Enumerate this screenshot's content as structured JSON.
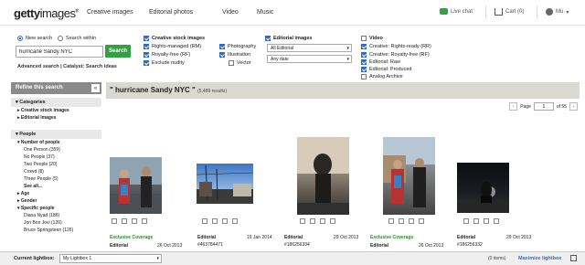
{
  "header": {
    "logo_bold": "getty",
    "logo_thin": "images",
    "logo_reg": "®",
    "nav": [
      "Creative images",
      "Editorial photos",
      "Video",
      "Music"
    ],
    "live_chat": "Live chat",
    "cart": "Cart (0)",
    "user": "Mu"
  },
  "search": {
    "mode_new": "New search",
    "mode_within": "Search within",
    "query": "hurricane Sandy NYC",
    "button": "Search",
    "advanced": "Advanced search",
    "divider": "|",
    "catalyst": "Catalyst: Search ideas"
  },
  "filters": {
    "creative_title": "Creative stock images",
    "creative_opts": [
      {
        "label": "Rights-managed (RM)",
        "checked": true
      },
      {
        "label": "Royalty-free (RF)",
        "checked": true
      },
      {
        "label": "Exclude nudity",
        "checked": true
      }
    ],
    "type_opts": [
      {
        "label": "Photography",
        "checked": true
      },
      {
        "label": "Illustration",
        "checked": true
      },
      {
        "label": "Vector",
        "checked": false
      }
    ],
    "editorial_title": "Editorial images",
    "editorial_select": "All Editorial",
    "date_select": "Any date",
    "video_title": "Video",
    "video_opts": [
      {
        "label": "Creative: Rights-ready (RR)",
        "checked": true
      },
      {
        "label": "Creative: Royalty-free (RF)",
        "checked": true
      },
      {
        "label": "Editorial: Raw",
        "checked": true
      },
      {
        "label": "Editorial: Produced",
        "checked": true
      },
      {
        "label": "Analog Archive",
        "checked": false
      }
    ]
  },
  "sidebar": {
    "title": "Refine this search",
    "collapse": "«",
    "categories_title": "Categories",
    "categories": [
      "Creative stock images",
      "Editorial images"
    ],
    "people_title": "People",
    "number_title": "Number of people",
    "number_items": [
      "One Person (359)",
      "No People (37)",
      "Two People (20)",
      "Crowd (8)",
      "Three People (5)"
    ],
    "see_all": "See all...",
    "age": "Age",
    "gender": "Gender",
    "specific_title": "Specific people",
    "specific_items": [
      "Diana Nyad (186)",
      "Jon Bon Jovi (126)",
      "Bruce Springsteen (126)"
    ]
  },
  "results": {
    "title": "\" hurricane Sandy NYC \"",
    "count": "(5,489 results)",
    "page_label": "Page",
    "page_value": "1",
    "page_total": "of 55",
    "prev": "‹",
    "next": "›"
  },
  "tiles": [
    {
      "top_label": "Exclusive Coverage",
      "license": "Editorial",
      "date": "26 Oct 2013",
      "id": ""
    },
    {
      "top_label": "",
      "license": "Editorial",
      "date": "19 Jan 2014",
      "id": "#463784471"
    },
    {
      "top_label": "",
      "license": "Editorial",
      "date": "29 Oct 2013",
      "id": "#186256334"
    },
    {
      "top_label": "Exclusive Coverage",
      "license": "Editorial",
      "date": "26 Oct 2013",
      "id": ""
    },
    {
      "top_label": "",
      "license": "Editorial",
      "date": "29 Oct 2013",
      "id": "#186256332"
    }
  ],
  "bottombar": {
    "label": "Current lightbox:",
    "select": "My Lightbox 1",
    "items": "(0 items)",
    "maximize": "Maximize lightbox"
  },
  "colors": {
    "green": "#2fa340",
    "blue": "#2b6cd3",
    "results_bar": "#d9d9d1",
    "sidebar_head": "#8a8a8a"
  }
}
